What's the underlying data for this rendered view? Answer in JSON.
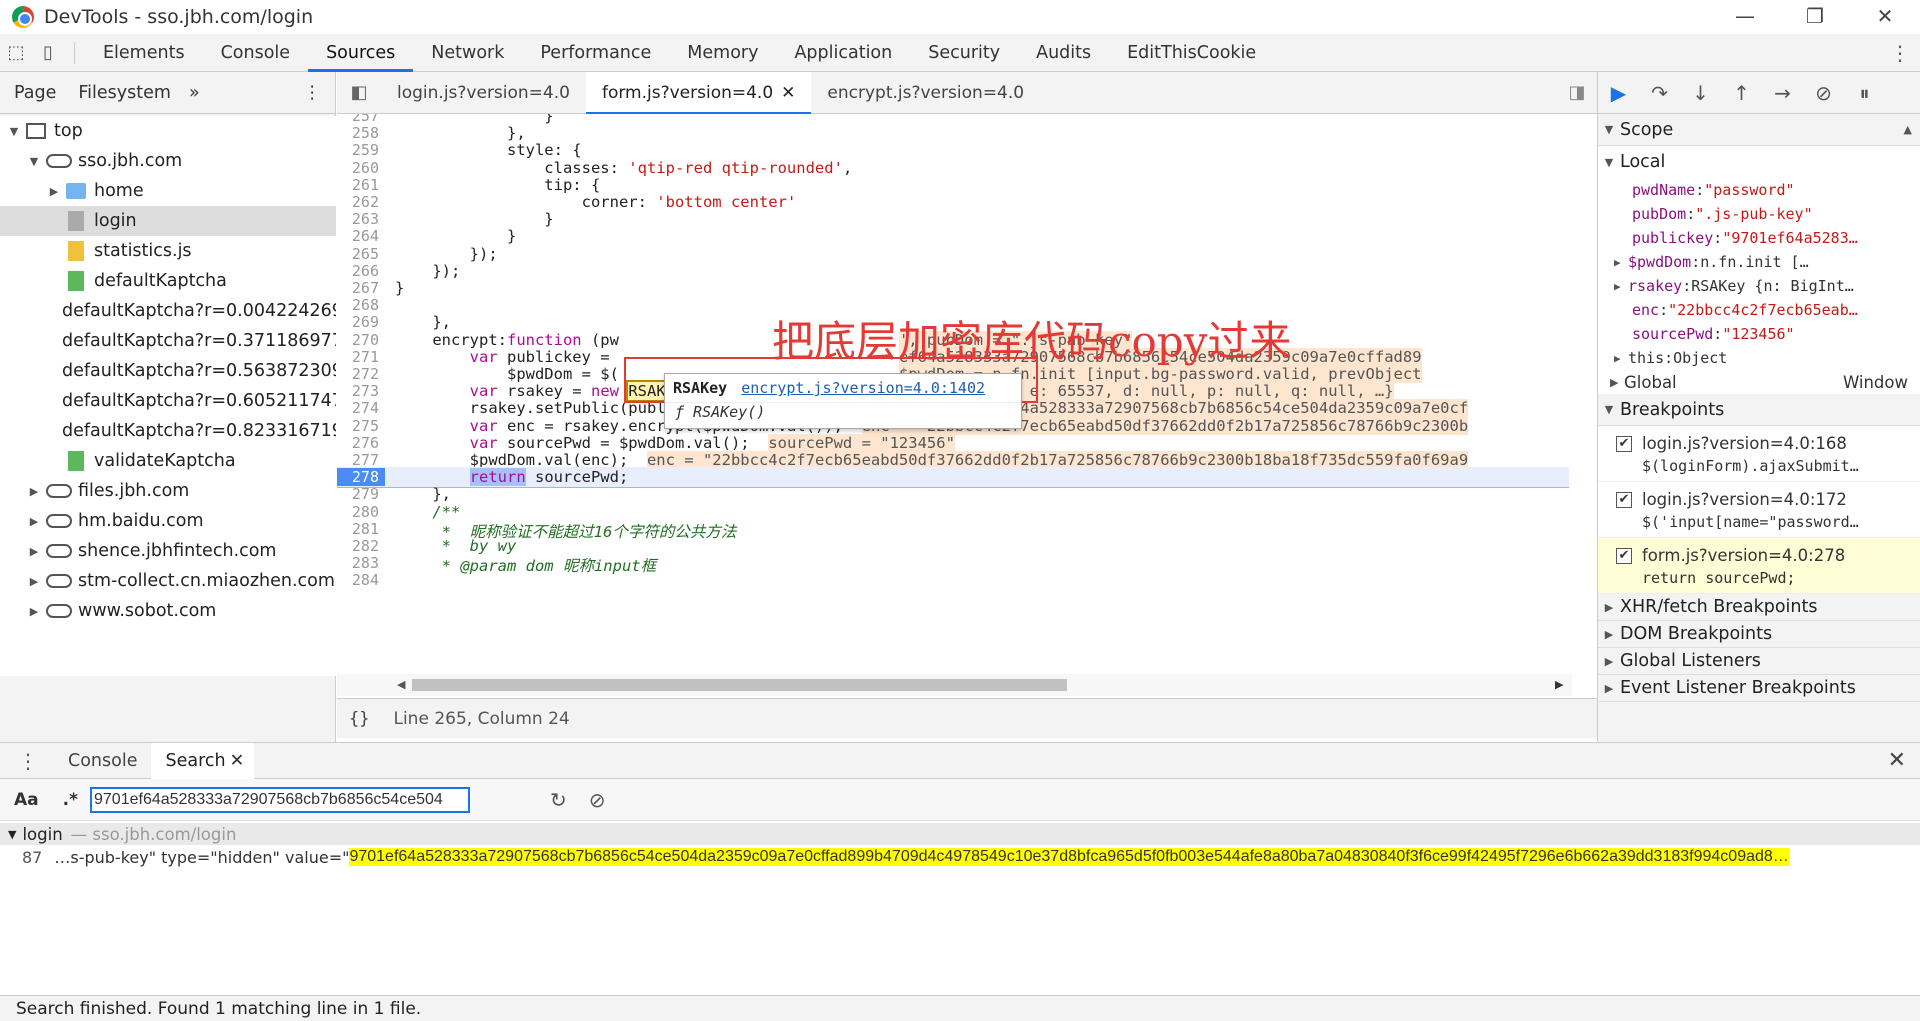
{
  "window": {
    "title": "DevTools - sso.jbh.com/login",
    "controls": [
      "—",
      "❐",
      "✕"
    ]
  },
  "panels": [
    "Elements",
    "Console",
    "Sources",
    "Network",
    "Performance",
    "Memory",
    "Application",
    "Security",
    "Audits",
    "EditThisCookie"
  ],
  "active_panel": "Sources",
  "navigator": {
    "tabs": [
      "Page",
      "Filesystem",
      "»"
    ],
    "tree": [
      {
        "label": "top",
        "depth": 0,
        "icon": "frame",
        "open": true
      },
      {
        "label": "sso.jbh.com",
        "depth": 1,
        "icon": "cloud",
        "open": true
      },
      {
        "label": "home",
        "depth": 2,
        "icon": "folder",
        "open": false
      },
      {
        "label": "login",
        "depth": 2,
        "icon": "file-gray",
        "selected": true
      },
      {
        "label": "statistics.js",
        "depth": 2,
        "icon": "file-yellow"
      },
      {
        "label": "defaultKaptcha",
        "depth": 2,
        "icon": "file-green"
      },
      {
        "label": "defaultKaptcha?r=0.004224269",
        "depth": 2,
        "icon": "file-green"
      },
      {
        "label": "defaultKaptcha?r=0.371186977",
        "depth": 2,
        "icon": "file-green"
      },
      {
        "label": "defaultKaptcha?r=0.563872309",
        "depth": 2,
        "icon": "file-green"
      },
      {
        "label": "defaultKaptcha?r=0.605211747",
        "depth": 2,
        "icon": "file-green"
      },
      {
        "label": "defaultKaptcha?r=0.823316719",
        "depth": 2,
        "icon": "file-green"
      },
      {
        "label": "validateKaptcha",
        "depth": 2,
        "icon": "file-green"
      },
      {
        "label": "files.jbh.com",
        "depth": 1,
        "icon": "cloud",
        "open": false
      },
      {
        "label": "hm.baidu.com",
        "depth": 1,
        "icon": "cloud",
        "open": false
      },
      {
        "label": "shence.jbhfintech.com",
        "depth": 1,
        "icon": "cloud",
        "open": false
      },
      {
        "label": "stm-collect.cn.miaozhen.com",
        "depth": 1,
        "icon": "cloud",
        "open": false
      },
      {
        "label": "www.sobot.com",
        "depth": 1,
        "icon": "cloud",
        "open": false
      }
    ]
  },
  "editor_tabs": [
    {
      "label": "login.js?version=4.0",
      "active": false
    },
    {
      "label": "form.js?version=4.0",
      "active": true,
      "closable": "✕"
    },
    {
      "label": "encrypt.js?version=4.0",
      "active": false
    }
  ],
  "code_lines": [
    {
      "n": "257",
      "parts": [
        [
          "",
          "                }"
        ]
      ]
    },
    {
      "n": "258",
      "parts": [
        [
          "",
          "            },"
        ]
      ]
    },
    {
      "n": "259",
      "parts": [
        [
          "",
          "            style: {"
        ]
      ]
    },
    {
      "n": "260",
      "parts": [
        [
          "",
          "                classes: "
        ],
        [
          "str",
          "'qtip-red qtip-rounded'"
        ],
        [
          "",
          ","
        ]
      ]
    },
    {
      "n": "261",
      "parts": [
        [
          "",
          "                tip: {"
        ]
      ]
    },
    {
      "n": "262",
      "parts": [
        [
          "",
          "                    corner: "
        ],
        [
          "str",
          "'bottom center'"
        ]
      ]
    },
    {
      "n": "263",
      "parts": [
        [
          "",
          "                }"
        ]
      ]
    },
    {
      "n": "264",
      "parts": [
        [
          "",
          "            }"
        ]
      ]
    },
    {
      "n": "265",
      "parts": [
        [
          "",
          "        });"
        ]
      ]
    },
    {
      "n": "266",
      "parts": [
        [
          "",
          "    });"
        ]
      ]
    },
    {
      "n": "267",
      "parts": [
        [
          "",
          "}"
        ]
      ]
    },
    {
      "n": "268",
      "parts": [
        [
          "",
          ""
        ]
      ]
    },
    {
      "n": "269",
      "parts": [
        [
          "",
          "    },"
        ]
      ]
    },
    {
      "n": "270",
      "parts": [
        [
          "",
          "    encrypt:"
        ],
        [
          "kw",
          "function"
        ],
        [
          "",
          " (pw"
        ],
        [
          "",
          "                              "
        ],
        [
          "inl",
          "', pubDom = \".js-pub-key\""
        ]
      ]
    },
    {
      "n": "271",
      "parts": [
        [
          "",
          "        "
        ],
        [
          "kw",
          "var"
        ],
        [
          "",
          " publickey = "
        ],
        [
          "",
          "                              "
        ],
        [
          "inl",
          "ef64a528333a72907568cb7b6856c54ce504da2359c09a7e0cffad89"
        ]
      ]
    },
    {
      "n": "272",
      "parts": [
        [
          "",
          "            $pwdDom = $("
        ],
        [
          "",
          "                              "
        ],
        [
          "inl",
          "$pwdDom = n.fn.init [input.bg-password.valid, prevObject"
        ]
      ]
    },
    {
      "n": "273",
      "parts": [
        [
          "",
          "        "
        ],
        [
          "kw",
          "var"
        ],
        [
          "",
          " rsakey = "
        ],
        [
          "kw",
          "new"
        ],
        [
          "",
          " "
        ],
        [
          "box",
          "RSAKey"
        ],
        [
          "",
          "();  "
        ],
        [
          "inl",
          "rsakey = RSAKey {n: BigInteger, e: 65537, d: null, p: null, q: null, …}"
        ]
      ]
    },
    {
      "n": "274",
      "parts": [
        [
          "",
          "        rsakey.setPublic(publickey, "
        ],
        [
          "str",
          "\"10001\""
        ],
        [
          "",
          ");  "
        ],
        [
          "inl",
          "publickey = \"9701ef64a528333a72907568cb7b6856c54ce504da2359c09a7e0cf"
        ]
      ]
    },
    {
      "n": "275",
      "parts": [
        [
          "",
          "        "
        ],
        [
          "kw",
          "var"
        ],
        [
          "",
          " enc = rsakey.encrypt($pwdDom.val());  "
        ],
        [
          "inl",
          "enc = \"22bbcc4c2f7ecb65eabd50df37662dd0f2b17a725856c78766b9c2300b"
        ]
      ]
    },
    {
      "n": "276",
      "parts": [
        [
          "",
          "        "
        ],
        [
          "kw",
          "var"
        ],
        [
          "",
          " sourcePwd = $pwdDom.val();  "
        ],
        [
          "inl",
          "sourcePwd = \"123456\""
        ]
      ]
    },
    {
      "n": "277",
      "parts": [
        [
          "",
          "        $pwdDom.val(enc);  "
        ],
        [
          "inl",
          "enc = \"22bbcc4c2f7ecb65eabd50df37662dd0f2b17a725856c78766b9c2300b18ba18f735dc559fa0f69a9"
        ]
      ]
    },
    {
      "n": "278",
      "parts": [
        [
          "",
          "        "
        ],
        [
          "kw",
          "return"
        ],
        [
          "",
          " sourcePwd;"
        ]
      ],
      "current": true
    },
    {
      "n": "279",
      "parts": [
        [
          "",
          "    },"
        ]
      ]
    },
    {
      "n": "280",
      "parts": [
        [
          "cm",
          "    /**"
        ]
      ]
    },
    {
      "n": "281",
      "parts": [
        [
          "cm",
          "     *  昵称验证不能超过16个字符的公共方法"
        ]
      ]
    },
    {
      "n": "282",
      "parts": [
        [
          "cm",
          "     *  by wy"
        ]
      ]
    },
    {
      "n": "283",
      "parts": [
        [
          "cm",
          "     * @param dom 昵称input框"
        ]
      ]
    },
    {
      "n": "284",
      "parts": [
        [
          "",
          ""
        ]
      ]
    }
  ],
  "tooltip": {
    "name": "RSAKey",
    "link": "encrypt.js?version=4.0:1402",
    "sig": "ƒ RSAKey()"
  },
  "annotation": "把底层加密库代码copy过来",
  "status": {
    "braces": "{}",
    "position": "Line 265, Column 24"
  },
  "scope": {
    "title": "Scope",
    "local_title": "Local",
    "vars": [
      {
        "k": "pwdName",
        "v": "\"password\"",
        "exp": false
      },
      {
        "k": "pubDom",
        "v": "\".js-pub-key\"",
        "exp": false
      },
      {
        "k": "publickey",
        "v": "\"9701ef64a5283…",
        "exp": false
      },
      {
        "k": "$pwdDom",
        "v": "n.fn.init […",
        "exp": true,
        "obj": true
      },
      {
        "k": "rsakey",
        "v": "RSAKey {n: BigInt…",
        "exp": true,
        "obj": true
      },
      {
        "k": "enc",
        "v": "\"22bbcc4c2f7ecb65eab…",
        "exp": false
      },
      {
        "k": "sourcePwd",
        "v": "\"123456\"",
        "exp": false
      },
      {
        "k": "this",
        "v": "Object",
        "exp": true,
        "obj": true,
        "plain": true
      }
    ],
    "global_label": "Global",
    "global_value": "Window"
  },
  "breakpoints": {
    "title": "Breakpoints",
    "items": [
      {
        "file": "login.js?version=4.0:168",
        "code": "$(loginForm).ajaxSubmit…",
        "hit": false
      },
      {
        "file": "login.js?version=4.0:172",
        "code": "$('input[name=\"password…",
        "hit": false
      },
      {
        "file": "form.js?version=4.0:278",
        "code": "return sourcePwd;",
        "hit": true
      }
    ]
  },
  "sections": [
    "XHR/fetch Breakpoints",
    "DOM Breakpoints",
    "Global Listeners",
    "Event Listener Breakpoints"
  ],
  "drawer": {
    "tabs": [
      "Console",
      "Search"
    ],
    "case_label": "Aa",
    "regex_label": ".*",
    "query": "9701ef64a528333a72907568cb7b6856c54ce504",
    "result_file": "login",
    "result_url": "— sso.jbh.com/login",
    "result_line": "87",
    "result_prefix": "…s-pub-key\" type=\"hidden\" value=\"",
    "result_match": "9701ef64a528333a72907568cb7b6856c54ce504da2359c09a7e0cffad899b4709d4c4978549c10e37d8bfca965d5f0fb003e544afe8a80ba7a04830840f3f6ce99f42495f7296e6b662a39dd3183f994c09ad8…",
    "finished": "Search finished.  Found 1 matching line in 1 file."
  }
}
